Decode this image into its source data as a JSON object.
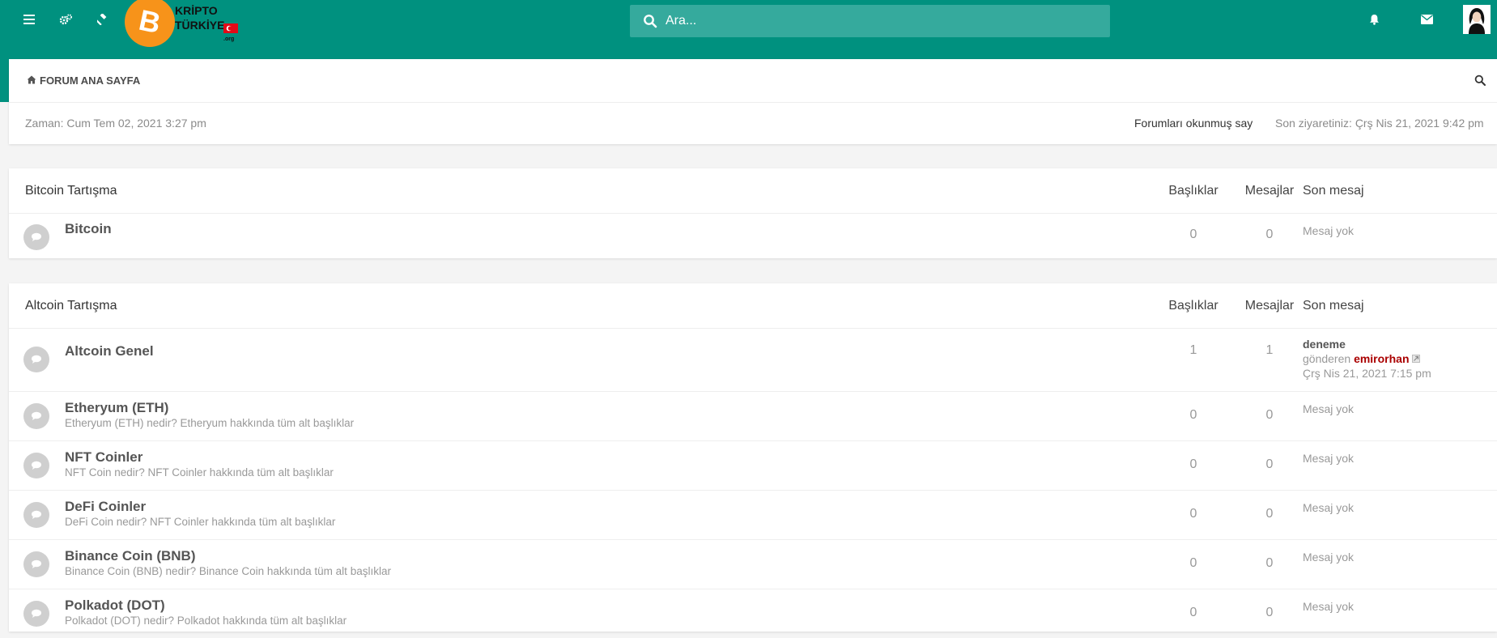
{
  "header": {
    "logo_text": [
      "KRİPTO",
      "TÜRKİYE",
      ".org"
    ],
    "search_placeholder": "Ara..."
  },
  "navbar": {
    "home_label": "FORUM ANA SAYFA"
  },
  "info": {
    "current_time": "Zaman: Cum Tem 02, 2021 3:27 pm",
    "mark_read": "Forumları okunmuş say",
    "last_visit": "Son ziyaretiniz: Çrş Nis 21, 2021 9:42 pm"
  },
  "columns": {
    "topics": "Başlıklar",
    "posts": "Mesajlar",
    "last_post": "Son mesaj"
  },
  "categories": [
    {
      "title": "Bitcoin Tartışma",
      "forums": [
        {
          "title": "Bitcoin",
          "desc": "",
          "topics": "0",
          "posts": "0",
          "last": "Mesaj yok"
        }
      ]
    },
    {
      "title": "Altcoin Tartışma",
      "forums": [
        {
          "title": "Altcoin Genel",
          "desc": "",
          "topics": "1",
          "posts": "1",
          "last_title": "deneme",
          "last_by": "gönderen",
          "last_author": "emirorhan",
          "last_date": "Çrş Nis 21, 2021 7:15 pm"
        },
        {
          "title": "Etheryum (ETH)",
          "desc": "Etheryum (ETH) nedir? Etheryum hakkında tüm alt başlıklar",
          "topics": "0",
          "posts": "0",
          "last": "Mesaj yok"
        },
        {
          "title": "NFT Coinler",
          "desc": "NFT Coin nedir? NFT Coinler hakkında tüm alt başlıklar",
          "topics": "0",
          "posts": "0",
          "last": "Mesaj yok"
        },
        {
          "title": "DeFi Coinler",
          "desc": "DeFi Coin nedir? NFT Coinler hakkında tüm alt başlıklar",
          "topics": "0",
          "posts": "0",
          "last": "Mesaj yok"
        },
        {
          "title": "Binance Coin (BNB)",
          "desc": "Binance Coin (BNB) nedir? Binance Coin hakkında tüm alt başlıklar",
          "topics": "0",
          "posts": "0",
          "last": "Mesaj yok"
        },
        {
          "title": "Polkadot (DOT)",
          "desc": "Polkadot (DOT) nedir? Polkadot hakkında tüm alt başlıklar",
          "topics": "0",
          "posts": "0",
          "last": "Mesaj yok"
        }
      ]
    }
  ],
  "colors": {
    "brand": "#00917f",
    "search_bg": "#35aa9d",
    "author": "#aa0000",
    "bitcoin_orange": "#f7931a"
  }
}
